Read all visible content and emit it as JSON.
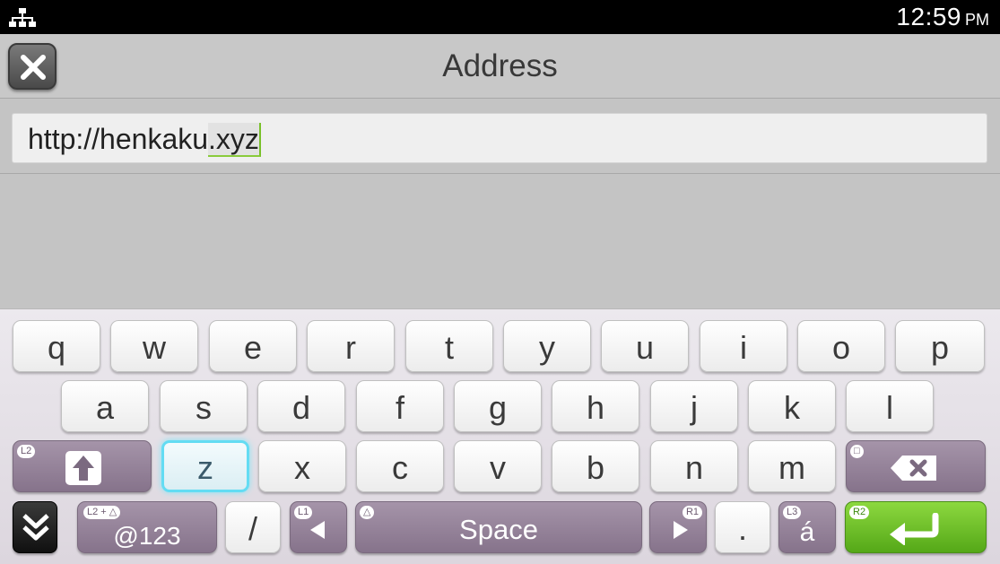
{
  "status_bar": {
    "network_icon": "network-icon",
    "time": "12:59",
    "ampm": "PM"
  },
  "header": {
    "title": "Address",
    "close_icon": "close-icon"
  },
  "address_field": {
    "prefix": "http://henkaku",
    "converting": ".xyz"
  },
  "keyboard": {
    "row1": [
      "q",
      "w",
      "e",
      "r",
      "t",
      "y",
      "u",
      "i",
      "o",
      "p"
    ],
    "row2": [
      "a",
      "s",
      "d",
      "f",
      "g",
      "h",
      "j",
      "k",
      "l"
    ],
    "row3": [
      "z",
      "x",
      "c",
      "v",
      "b",
      "n",
      "m"
    ],
    "selected_key": "z",
    "shift": {
      "tag": "L2",
      "icon": "shift-arrow-icon"
    },
    "backspace": {
      "tag": "□",
      "icon": "backspace-icon"
    },
    "hide": {
      "icon": "hide-keyboard-icon"
    },
    "symbols": {
      "tag": "L2 + △",
      "label": "@123"
    },
    "slash": "/",
    "cursor_left": {
      "tag": "L1",
      "icon": "cursor-left-icon"
    },
    "space": {
      "tag": "△",
      "label": "Space"
    },
    "cursor_right": {
      "tag": "R1",
      "icon": "cursor-right-icon"
    },
    "dot": ".",
    "accent": {
      "tag": "L3",
      "label": "á"
    },
    "enter": {
      "tag": "R2",
      "icon": "enter-icon"
    },
    "colors": {
      "enter": "#6cc22b",
      "selection": "#63dcf3",
      "function_key": "#978399"
    }
  }
}
